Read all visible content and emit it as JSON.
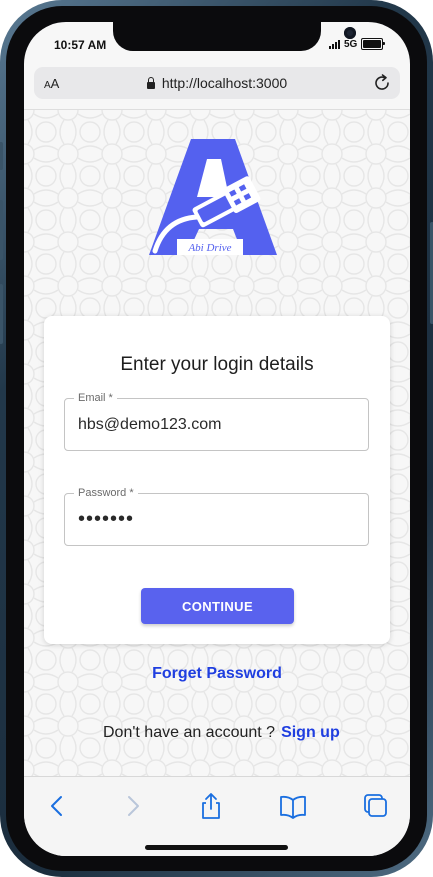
{
  "status_bar": {
    "time": "10:57 AM",
    "network": "5G"
  },
  "browser": {
    "text_size_label_big": "A",
    "text_size_label_small": "A",
    "url": "http://localhost:3000"
  },
  "logo": {
    "brand_text": "Abi Drive",
    "color": "#5461ef"
  },
  "login": {
    "title": "Enter your login details",
    "email_label": "Email *",
    "email_value": "hbs@demo123.com",
    "password_label": "Password *",
    "password_value": "•••••••",
    "continue_label": "CONTINUE",
    "forget_password": "Forget Password",
    "signup_prompt": "Don't have an account ?",
    "signup_link": "Sign up"
  },
  "toolbar": {
    "icons": [
      "back-icon",
      "forward-icon",
      "share-icon",
      "bookmarks-icon",
      "tabs-icon"
    ]
  },
  "colors": {
    "accent": "#5962ee",
    "link": "#1f3ee0",
    "toolbar_icon": "#1a6fe0",
    "toolbar_icon_disabled": "#b9c6da"
  }
}
